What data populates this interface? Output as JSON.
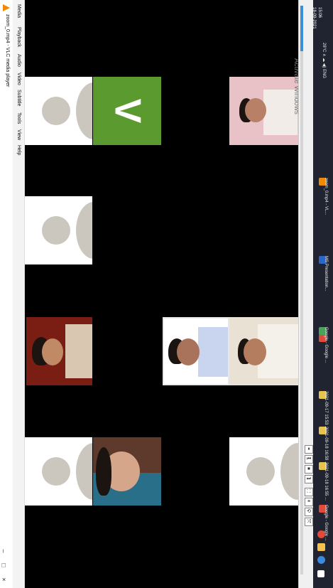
{
  "window": {
    "title": "zoom_0.mp4 - VLC media player",
    "minimize": "–",
    "maximize": "□",
    "close": "×"
  },
  "menu": [
    "Media",
    "Playback",
    "Audio",
    "Video",
    "Subtitle",
    "Tools",
    "View",
    "Help"
  ],
  "tiles": {
    "avatar_letter": "V",
    "watermark": "Activate Windows"
  },
  "player": {
    "progress": 0.08,
    "buttons": [
      "⏸",
      "⏮",
      "⏹",
      "⏭",
      "⛶",
      "≡",
      "⟲",
      "⤨"
    ]
  },
  "taskbar": {
    "items": [
      {
        "label": "Google - Google ...",
        "color": "#e04a3a"
      },
      {
        "label": "2021-09-18 16:55 ...",
        "color": "#e6c34a"
      },
      {
        "label": "2021-09-18 16:59 ...",
        "color": "#e6c34a"
      },
      {
        "label": "2021-09-17 15:53 ...",
        "color": "#e6c34a"
      },
      {
        "label": "Google - Google ...",
        "color": "#4aa35a"
      },
      {
        "label": "MS Presentation...",
        "color": "#2a66c8"
      },
      {
        "label": "zoom_0.mp4 - VL...",
        "color": "#f08a00"
      }
    ],
    "tray": "28°C  ∧  ☁  ◀)  ENG",
    "time": "15:06",
    "date": "18-09-2021"
  },
  "colors": {
    "avatar_green": "#5a9a2e",
    "seek_blue": "#3b8fd6",
    "vlc_orange": "#f08a00"
  }
}
